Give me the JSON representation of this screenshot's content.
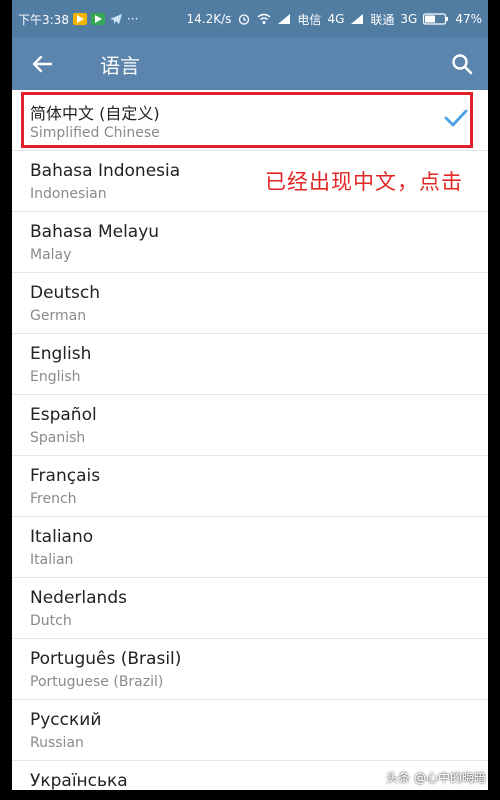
{
  "status_bar": {
    "time": "下午3:38",
    "speed": "14.2K/s",
    "carrier1": "电信",
    "net1": "4G",
    "carrier2": "联通",
    "net2": "3G",
    "battery": "47%",
    "more": "···"
  },
  "appbar": {
    "title": "语言"
  },
  "languages": [
    {
      "name": "简体中文 (自定义)",
      "sub": "Simplified Chinese",
      "selected": true
    },
    {
      "name": "Bahasa Indonesia",
      "sub": "Indonesian"
    },
    {
      "name": "Bahasa Melayu",
      "sub": "Malay"
    },
    {
      "name": "Deutsch",
      "sub": "German"
    },
    {
      "name": "English",
      "sub": "English"
    },
    {
      "name": "Español",
      "sub": "Spanish"
    },
    {
      "name": "Français",
      "sub": "French"
    },
    {
      "name": "Italiano",
      "sub": "Italian"
    },
    {
      "name": "Nederlands",
      "sub": "Dutch"
    },
    {
      "name": "Português (Brasil)",
      "sub": "Portuguese (Brazil)"
    },
    {
      "name": "Русский",
      "sub": "Russian"
    },
    {
      "name": "Українська",
      "sub": ""
    }
  ],
  "annotation": "已经出现中文，点击",
  "watermark": "头条 @心中的晦暗",
  "colors": {
    "appbar": "#5b85ac",
    "statusbar": "#527da3",
    "check": "#4d9fe0",
    "highlight": "#e0202a",
    "annotation": "#e32626"
  }
}
